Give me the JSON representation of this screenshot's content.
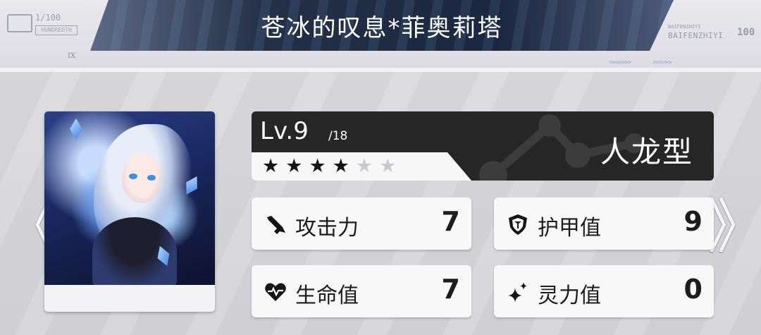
{
  "header": {
    "title": "苍冰的叹息*菲奥莉塔",
    "left_logo_number": "1/100",
    "left_logo_sub": "HUNDREDTH",
    "left_logo_numeral": "IX",
    "right_logo_small": "BAIFENZHIYI",
    "right_logo_big": "BAIFENZHIYI",
    "right_logo_number": "100",
    "chevrons_1": ">>>>>>>",
    "chevrons_2": ">>>>>>"
  },
  "character": {
    "level_label": "Lv.9",
    "level_max": "/18",
    "stars_total": 6,
    "stars_filled": 4,
    "type": "人龙型"
  },
  "stats": [
    {
      "name": "attack",
      "label": "攻击力",
      "value": "7",
      "icon": "sword-icon"
    },
    {
      "name": "armor",
      "label": "护甲值",
      "value": "9",
      "icon": "shield-icon"
    },
    {
      "name": "health",
      "label": "生命值",
      "value": "7",
      "icon": "heart-pulse-icon"
    },
    {
      "name": "spirit",
      "label": "灵力值",
      "value": "0",
      "icon": "sparkle-icon"
    }
  ],
  "nav": {
    "prev": "《",
    "next": "》"
  },
  "colors": {
    "accent": "#8fc6e6",
    "panel_dark": "#262626",
    "title_bar": "#1b2740"
  }
}
